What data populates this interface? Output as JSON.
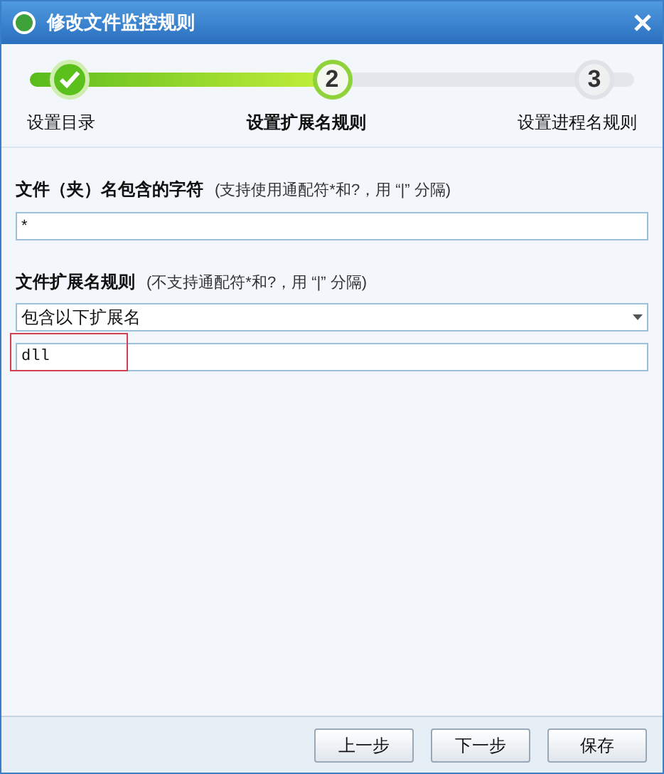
{
  "window": {
    "title": "修改文件监控规则"
  },
  "steps": [
    {
      "label": "设置目录",
      "kind": "done"
    },
    {
      "number": "2",
      "label": "设置扩展名规则",
      "kind": "current"
    },
    {
      "number": "3",
      "label": "设置进程名规则",
      "kind": "pending"
    }
  ],
  "name_rule": {
    "label": "文件（夹）名包含的字符",
    "hint": "(支持使用通配符*和?，用 “|” 分隔)",
    "value": "*"
  },
  "ext_rule": {
    "label": "文件扩展名规则",
    "hint": "(不支持通配符*和?，用 “|” 分隔)",
    "mode": "包含以下扩展名",
    "value": "dll"
  },
  "buttons": [
    "上一步",
    "下一步",
    "保存"
  ]
}
